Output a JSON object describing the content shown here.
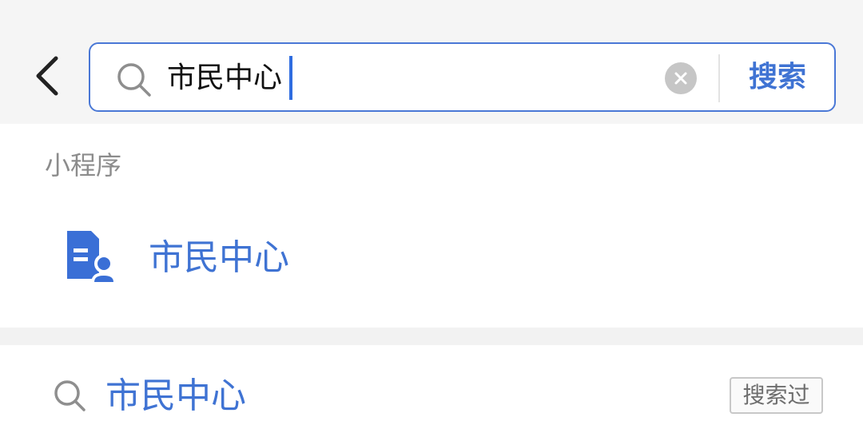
{
  "header": {
    "back_icon": "chevron-left-icon",
    "search": {
      "query": "市民中心",
      "search_icon": "search-icon",
      "clear_icon": "clear-icon",
      "submit_label": "搜索"
    }
  },
  "mini_programs": {
    "section_title": "小程序",
    "items": [
      {
        "label": "市民中心",
        "icon": "citizen-center-app-icon"
      }
    ]
  },
  "history": {
    "items": [
      {
        "label": "市民中心",
        "badge": "搜索过",
        "icon": "search-icon"
      }
    ]
  },
  "colors": {
    "accent": "#3f73d3",
    "border_focus": "#4a78d6",
    "app_icon": "#3a6fd6",
    "background": "#f5f5f5"
  }
}
